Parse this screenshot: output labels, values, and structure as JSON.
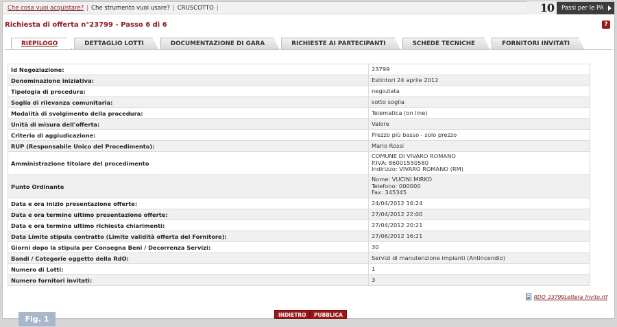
{
  "topbar": {
    "link_acquistare": "Che cosa vuoi acquistare?",
    "link_strumento": "Che strumento vuoi usare?",
    "link_cruscotto": "CRUSCOTTO",
    "separator": "|"
  },
  "badge": {
    "number": "10",
    "label": "Passi per le PA"
  },
  "page": {
    "title": "Richiesta di offerta n°23799 - Passo 6 di 6",
    "help_glyph": "?"
  },
  "tabs": [
    {
      "label": "RIEPILOGO",
      "active": true
    },
    {
      "label": "DETTAGLIO LOTTI"
    },
    {
      "label": "DOCUMENTAZIONE DI GARA"
    },
    {
      "label": "RICHIESTE AI PARTECIPANTI"
    },
    {
      "label": "SCHEDE TECNICHE"
    },
    {
      "label": "FORNITORI INVITATI"
    }
  ],
  "rows": [
    {
      "key": "Id Negoziazione:",
      "value": [
        "23799"
      ]
    },
    {
      "key": "Denominazione iniziativa:",
      "value": [
        "Estintori 24 aprile 2012"
      ]
    },
    {
      "key": "Tipologia di procedura:",
      "value": [
        "negoziata"
      ]
    },
    {
      "key": "Soglia di rilevanza comunitaria:",
      "value": [
        "sotto soglia"
      ]
    },
    {
      "key": "Modalità di svolgimento della procedura:",
      "value": [
        "Telematica (on line)"
      ]
    },
    {
      "key": "Unità di misura dell'offerta:",
      "value": [
        "Valore"
      ]
    },
    {
      "key": "Criterio di aggiudicazione:",
      "value": [
        "Prezzo più basso - solo prezzo"
      ]
    },
    {
      "key": "RUP (Responsabile Unico del Procedimento):",
      "value": [
        "Mario Rossi"
      ]
    },
    {
      "key": "Amministrazione titolare del procedimento",
      "value": [
        "COMUNE DI VIVARO ROMANO",
        "P.IVA: 86001550580",
        "Indirizzo: VIVARO ROMANO (RM)"
      ]
    },
    {
      "key": "Punto Ordinante",
      "value": [
        "Nome: VUCINI MIRKO",
        "Telefono: 000000",
        "Fax: 345345"
      ]
    },
    {
      "key": "Data e ora inizio presentazione offerte:",
      "value": [
        "24/04/2012 16:24"
      ]
    },
    {
      "key": "Data e ora termine ultimo presentazione offerte:",
      "value": [
        "27/04/2012 22:00"
      ]
    },
    {
      "key": "Data e ora termine ultimo richiesta chiarimenti:",
      "value": [
        "27/04/2012 20:21"
      ]
    },
    {
      "key": "Data Limite stipula contratto (Limite validità offerta del Fornitore):",
      "value": [
        "27/06/2012 16:21"
      ]
    },
    {
      "key": "Giorni dopo la stipula per Consegna Beni / Decorrenza Servizi:",
      "value": [
        "30"
      ]
    },
    {
      "key": "Bandi / Categorie oggetto della RdO:",
      "value": [
        "Servizi di manutenzione impianti (Antincendio)"
      ]
    },
    {
      "key": "Numero di Lotti:",
      "value": [
        "1"
      ]
    },
    {
      "key": "Numero fornitori invitati:",
      "value": [
        "3"
      ]
    }
  ],
  "attachment": {
    "label": "RDO_23799Lettera_Invito.rtf",
    "icon": "document-icon"
  },
  "buttons": {
    "back": "INDIETRO",
    "publish": "PUBBLICA"
  },
  "caption": "Fig. 1",
  "colors": {
    "accent": "#a31414",
    "badge_bg": "#3d3d3d",
    "caption_bg": "#a8b8cc"
  }
}
